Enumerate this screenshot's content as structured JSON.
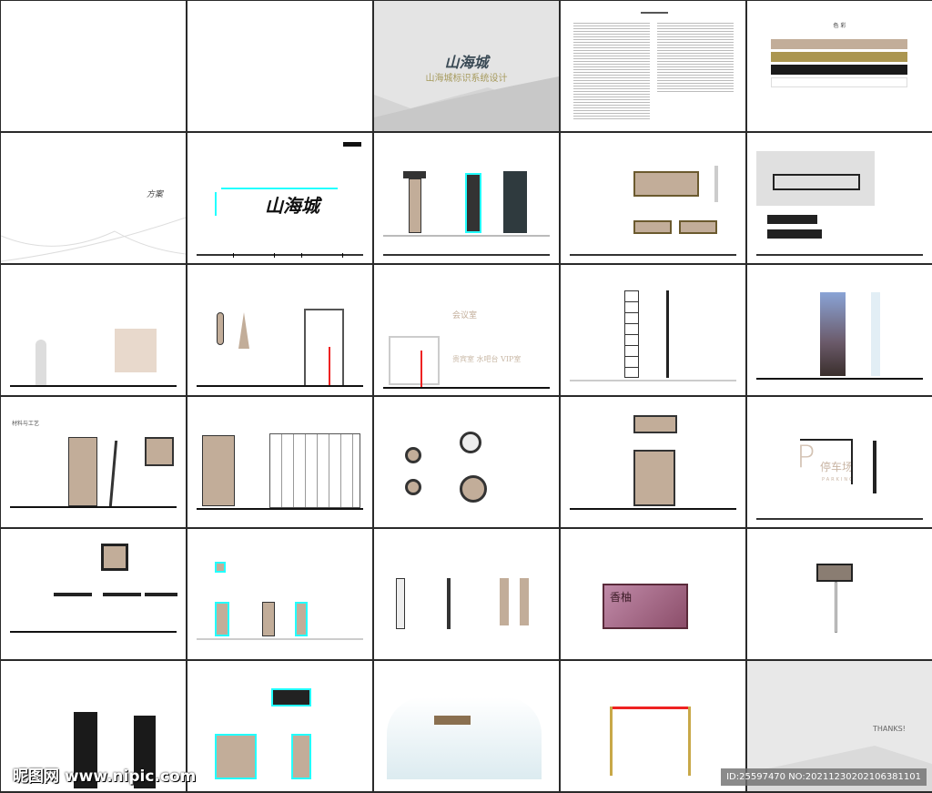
{
  "cover": {
    "logo": "山海城",
    "subtitle": "山海城标识系统设计"
  },
  "colors_page": {
    "title": "色 彩",
    "swatches": [
      "#c2ad99",
      "#ab9650",
      "#1a1a1a",
      "#ffffff"
    ]
  },
  "section": {
    "title": "方案"
  },
  "logo_page": {
    "logo": "山海城"
  },
  "room_signs": {
    "meeting": "会议室",
    "vip": "贵宾室 水吧台 VIP室"
  },
  "parking": {
    "cn": "停车场",
    "en": "PARKING",
    "letter": "P"
  },
  "menu_page": {
    "title": "材料与工艺"
  },
  "doorplate": {
    "name": "香柚"
  },
  "thanks": {
    "text": "THANKS!"
  },
  "watermark": {
    "site": "昵图网 www.nipic.com",
    "id": "ID:25597470 NO:20211230202106381101"
  }
}
